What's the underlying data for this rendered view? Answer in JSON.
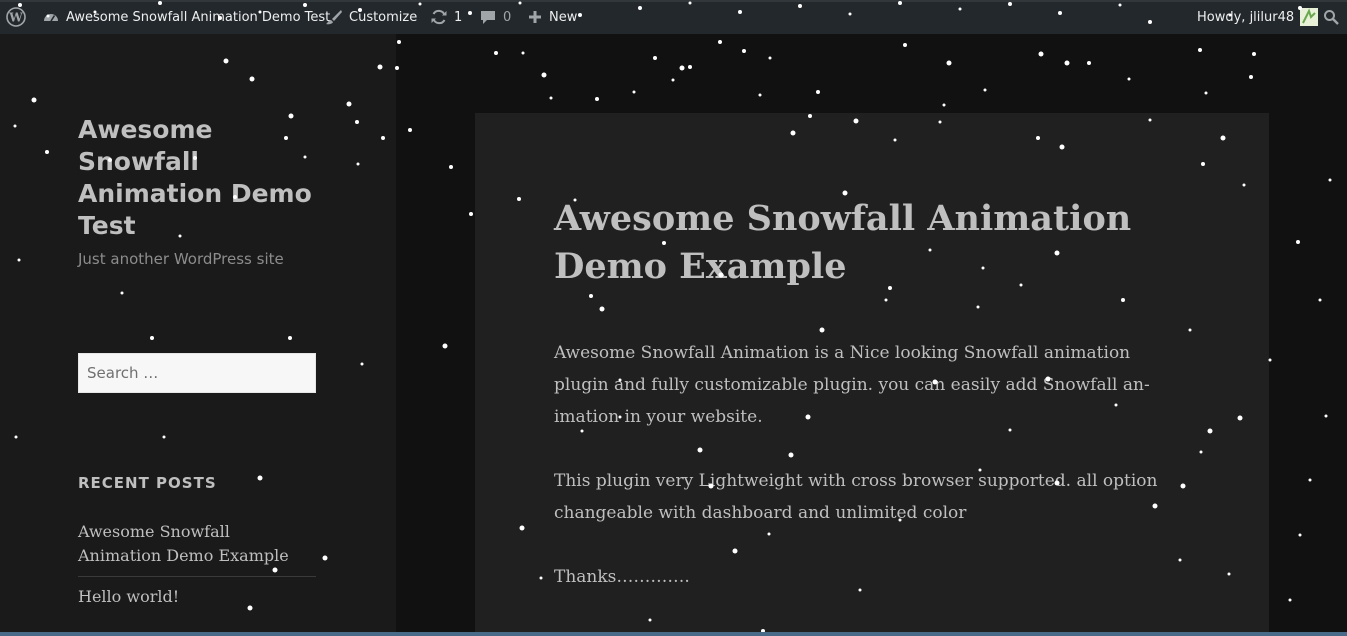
{
  "admin_bar": {
    "site_name": "Awesome Snowfall Animation Demo Test",
    "customize": "Customize",
    "updates_count": "1",
    "comments_count": "0",
    "new_label": "New",
    "howdy": "Howdy, jlilur48"
  },
  "sidebar": {
    "site_title": "Awesome Snowfall Animation Demo Test",
    "site_description": "Just another WordPress site",
    "search_placeholder": "Search …",
    "recent_posts_heading": "RECENT POSTS",
    "recent_posts": [
      "Awesome Snowfall Animation Demo Example",
      "Hello world!"
    ]
  },
  "article": {
    "title": "Awesome Snowfall Animation Demo Example",
    "paragraphs": [
      "Awesome Snowfall Animation is a Nice looking Snowfall animation plugin and fully customizable plugin. you can easily add Snowfall an­imation in your website.",
      "This plugin very Lightweight with cross browser supported. all op­tion changeable with dashboard and unlimited color",
      "Thanks…………."
    ]
  },
  "colors": {
    "admin_bar": "#23282d",
    "sidebar_bg": "#1a1a1a",
    "page_bg": "#111111",
    "article_bg": "#202020",
    "text": "#bfbfbf",
    "snow": "#ffffff"
  }
}
